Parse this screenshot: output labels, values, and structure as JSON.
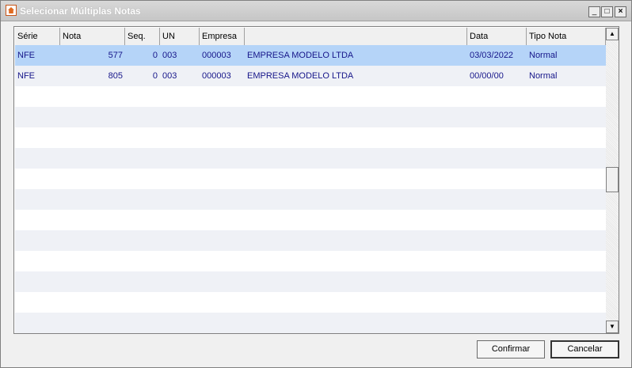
{
  "window": {
    "title": "Selecionar Múltiplas Notas",
    "controls": {
      "minimize": "_",
      "maximize": "□",
      "close": "×"
    }
  },
  "table": {
    "columns": [
      "Série",
      "Nota",
      "Seq.",
      "UN",
      "Empresa",
      "",
      "Data",
      "Tipo Nota"
    ],
    "rows": [
      {
        "serie": "NFE",
        "nota": "577",
        "seq": "0",
        "un": "003",
        "empresa": "000003",
        "nome": "EMPRESA MODELO LTDA",
        "data": "03/03/2022",
        "tipo": "Normal"
      },
      {
        "serie": "NFE",
        "nota": "805",
        "seq": "0",
        "un": "003",
        "empresa": "000003",
        "nome": "EMPRESA MODELO LTDA",
        "data": "00/00/00",
        "tipo": "Normal"
      }
    ],
    "selected_row": 0
  },
  "scrollbar": {
    "up": "▲",
    "down": "▼"
  },
  "buttons": {
    "confirm": "Confirmar",
    "cancel": "Cancelar"
  },
  "colors": {
    "selected_row": "#b5d4f8",
    "text": "#16168a",
    "alt_row": "#eff1f6"
  }
}
